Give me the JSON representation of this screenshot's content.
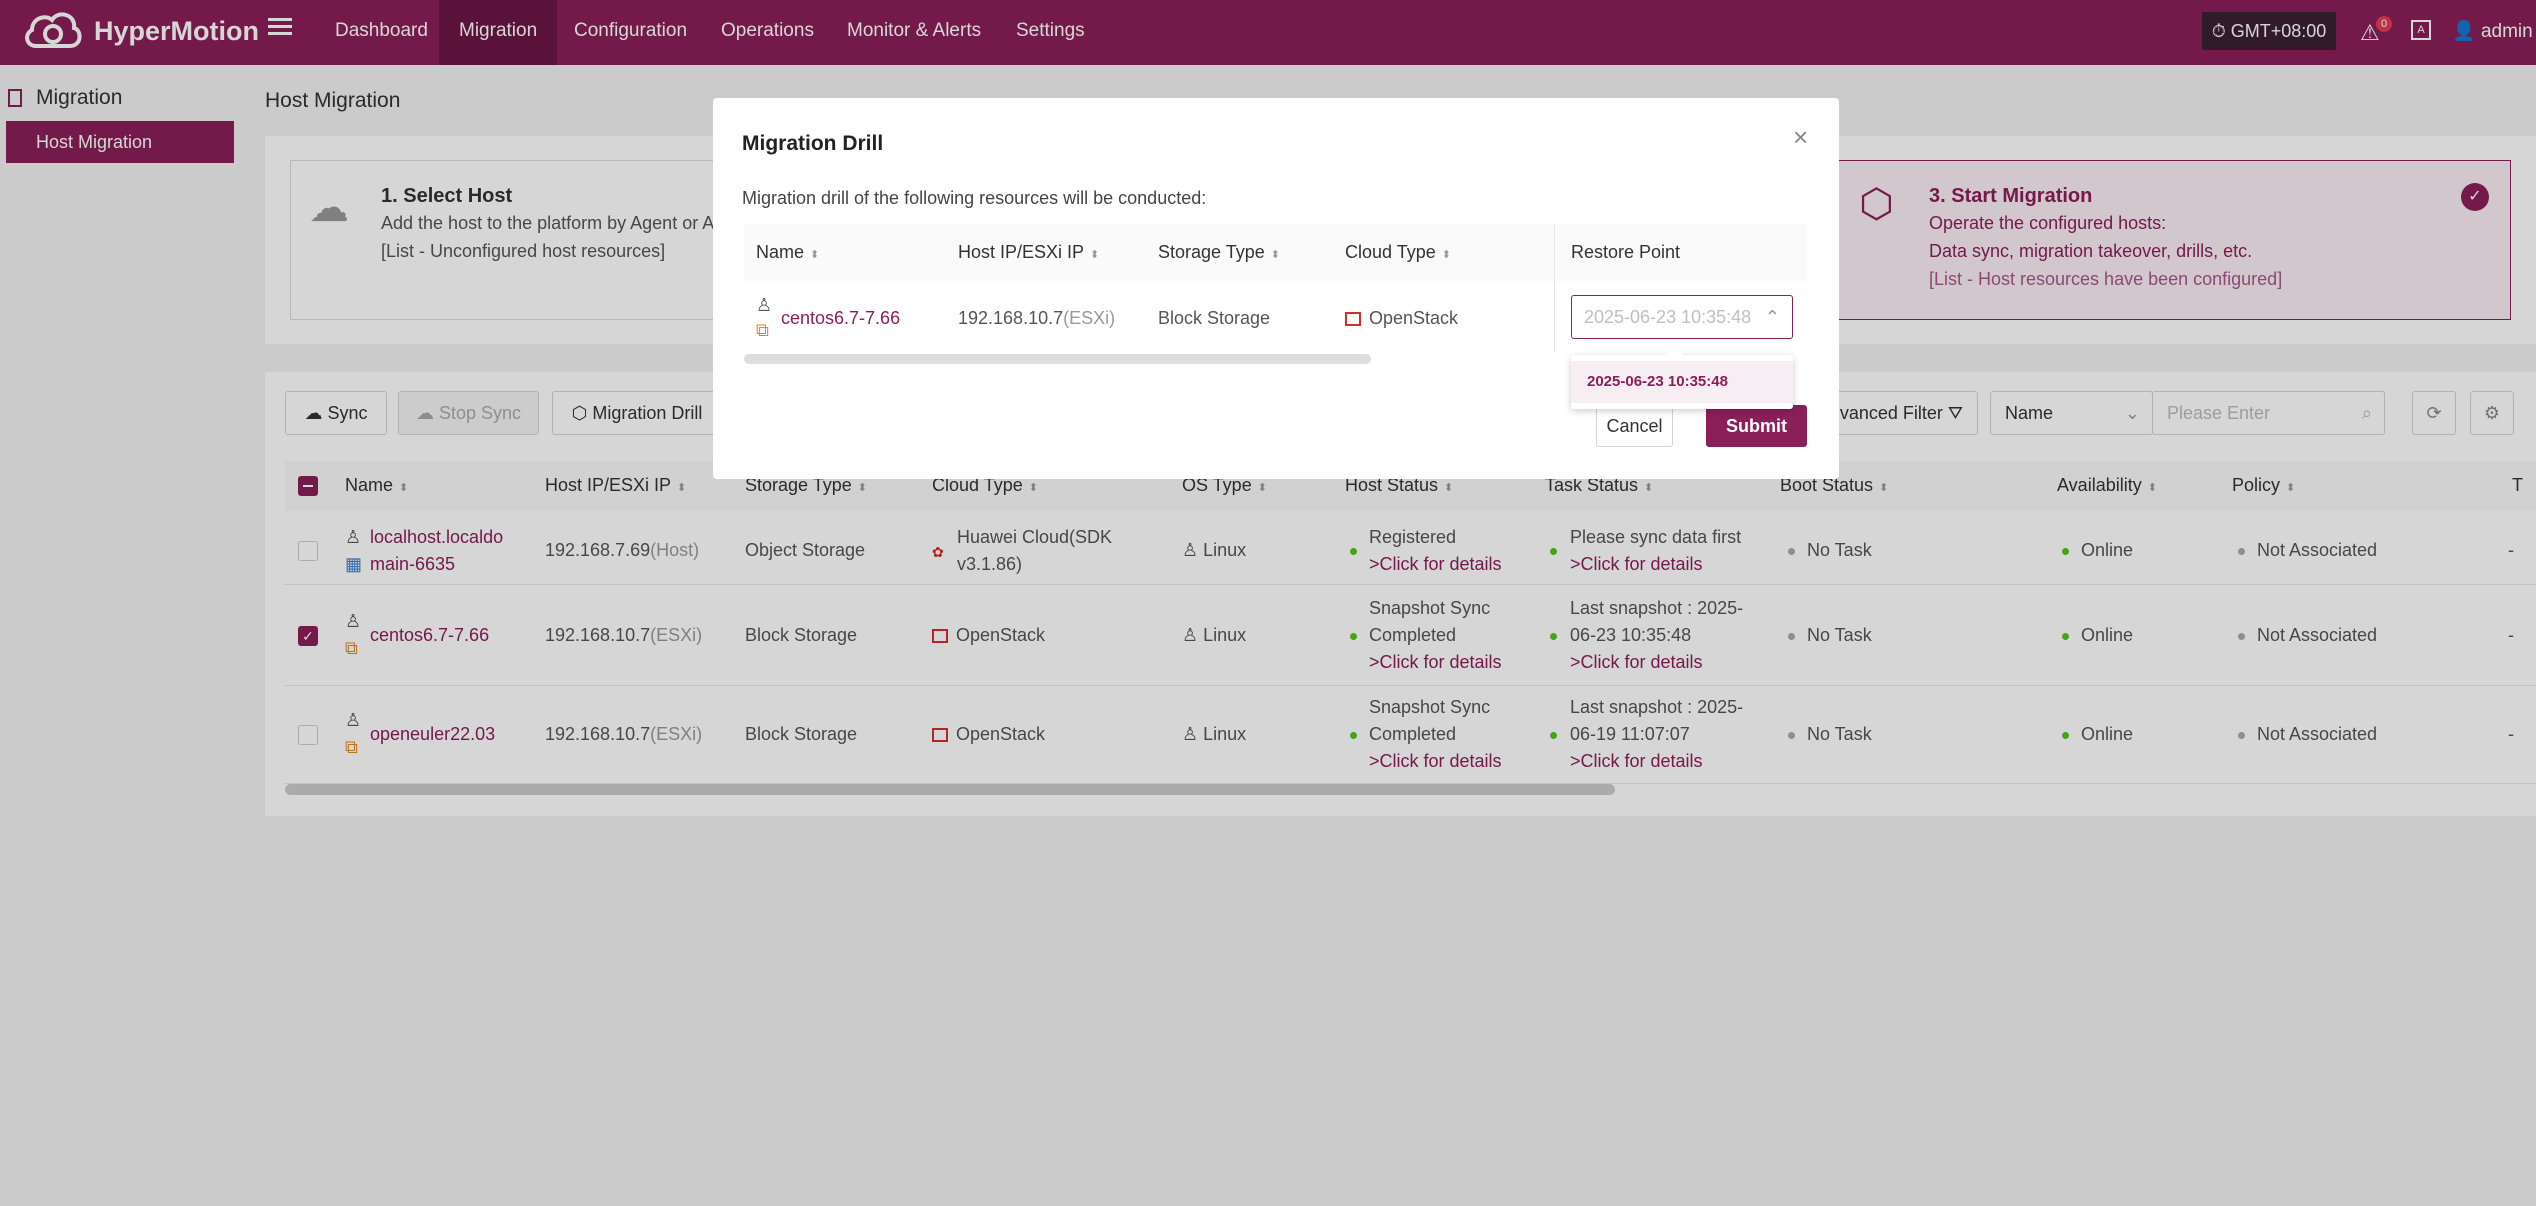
{
  "app": {
    "name": "HyperMotion"
  },
  "nav": {
    "items": [
      "Dashboard",
      "Migration",
      "Configuration",
      "Operations",
      "Monitor & Alerts",
      "Settings"
    ],
    "timezone": "GMT+08:00",
    "alert_count": "0",
    "user": "admin"
  },
  "sidebar": {
    "section": "Migration",
    "item": "Host Migration"
  },
  "page": {
    "title": "Host Migration"
  },
  "steps": [
    {
      "title": "1. Select Host",
      "line1": "Add the host to the platform by Agent or A",
      "line2": "[List - Unconfigured host resources]"
    },
    {
      "title": "3. Start Migration",
      "line1": "Operate the configured hosts:",
      "line2": "Data sync, migration takeover, drills, etc.",
      "line3": "[List - Host resources have been configured]"
    }
  ],
  "toolbar": {
    "sync": "Sync",
    "stop_sync": "Stop Sync",
    "migration_drill": "Migration Drill",
    "advanced_filter": "vanced Filter",
    "filter_field": "Name",
    "search_placeholder": "Please Enter"
  },
  "table": {
    "headers": [
      "Name",
      "Host IP/ESXi IP",
      "Storage Type",
      "Cloud Type",
      "OS Type",
      "Host Status",
      "Task Status",
      "Boot Status",
      "Availability",
      "Policy",
      "T"
    ],
    "rows": [
      {
        "name1": "localhost.localdo",
        "name2": "main-6635",
        "ip": "192.168.7.69",
        "ip_type": "(Host)",
        "storage": "Object Storage",
        "cloud1": "Huawei Cloud(SDK",
        "cloud2": "v3.1.86)",
        "os": "Linux",
        "host_status1": "Registered",
        "host_status_link": ">Click for details",
        "task1": "Please sync data first",
        "task_link": ">Click for details",
        "boot": "No Task",
        "availability": "Online",
        "policy": "Not Associated",
        "extra": "-"
      },
      {
        "name1": "centos6.7-7.66",
        "ip": "192.168.10.7",
        "ip_type": "(ESXi)",
        "storage": "Block Storage",
        "cloud1": "OpenStack",
        "os": "Linux",
        "host_status1": "Snapshot Sync",
        "host_status2": "Completed",
        "host_status_link": ">Click for details",
        "task1": "Last snapshot : 2025-",
        "task2": "06-23 10:35:48",
        "task_link": ">Click for details",
        "boot": "No Task",
        "availability": "Online",
        "policy": "Not Associated",
        "extra": "-"
      },
      {
        "name1": "openeuler22.03",
        "ip": "192.168.10.7",
        "ip_type": "(ESXi)",
        "storage": "Block Storage",
        "cloud1": "OpenStack",
        "os": "Linux",
        "host_status1": "Snapshot Sync",
        "host_status2": "Completed",
        "host_status_link": ">Click for details",
        "task1": "Last snapshot : 2025-",
        "task2": "06-19 11:07:07",
        "task_link": ">Click for details",
        "boot": "No Task",
        "availability": "Online",
        "policy": "Not Associated",
        "extra": "-"
      }
    ]
  },
  "modal": {
    "title": "Migration Drill",
    "description": "Migration drill of the following resources will be conducted:",
    "headers": [
      "Name",
      "Host IP/ESXi IP",
      "Storage Type",
      "Cloud Type",
      "Restore Point"
    ],
    "row": {
      "name": "centos6.7-7.66",
      "ip": "192.168.10.7",
      "ip_type": "(ESXi)",
      "storage": "Block Storage",
      "cloud": "OpenStack"
    },
    "restore_point_placeholder": "2025-06-23 10:35:48",
    "dropdown_option": "2025-06-23 10:35:48",
    "cancel": "Cancel",
    "submit": "Submit"
  },
  "colors": {
    "brand": "#8a1f5a",
    "online": "#52c41a"
  }
}
